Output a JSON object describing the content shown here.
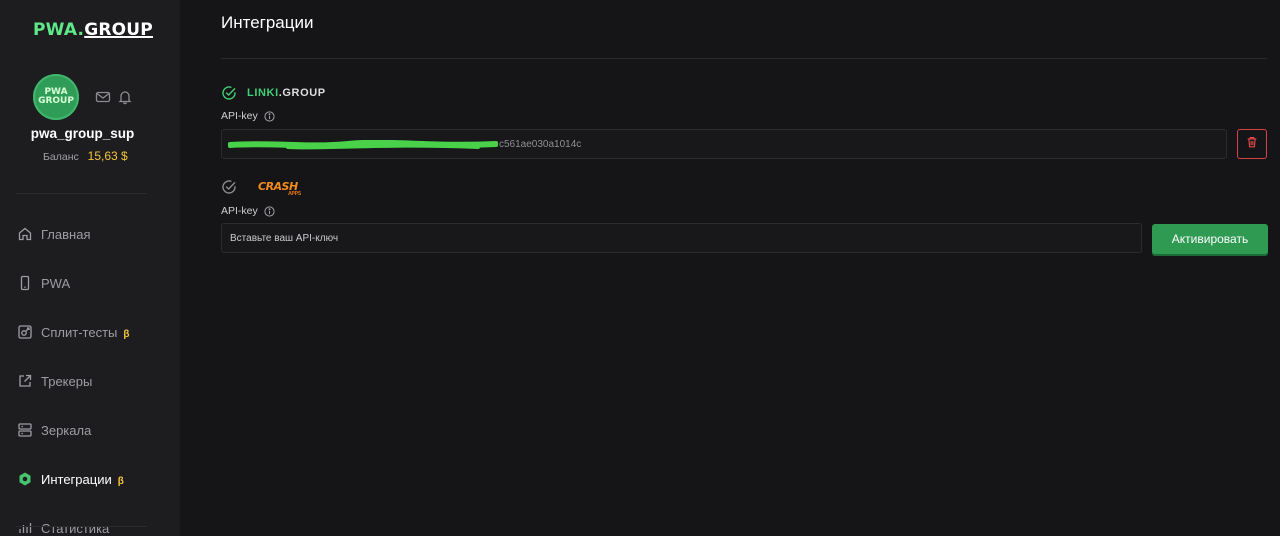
{
  "sidebar": {
    "logo_left": "PWA",
    "logo_dot": ".",
    "logo_right": "GROUP",
    "avatar_text_top": "PWA",
    "avatar_text_bottom": "GROUP",
    "username": "pwa_group_sup",
    "balance_label": "Баланс",
    "balance_value": "15,63 $",
    "beta_symbol": "β",
    "items": [
      {
        "label": "Главная",
        "icon": "home-icon",
        "beta": false,
        "active": false
      },
      {
        "label": "PWA",
        "icon": "phone-icon",
        "beta": false,
        "active": false
      },
      {
        "label": "Сплит-тесты",
        "icon": "split-icon",
        "beta": true,
        "active": false
      },
      {
        "label": "Трекеры",
        "icon": "share-icon",
        "beta": false,
        "active": false
      },
      {
        "label": "Зеркала",
        "icon": "server-icon",
        "beta": false,
        "active": false
      },
      {
        "label": "Интеграции",
        "icon": "integrations-icon",
        "beta": true,
        "active": true
      },
      {
        "label": "Статистика",
        "icon": "chart-icon",
        "beta": false,
        "active": false
      }
    ]
  },
  "main": {
    "title": "Интеграции",
    "integrations": [
      {
        "logo_accent": "LINKI",
        "logo_rest": ".GROUP",
        "connected": true,
        "field_label": "API-key",
        "key_visible_tail": "c561ae030a1014c"
      },
      {
        "logo_text": "CRASH",
        "logo_subtext": "APPS",
        "connected": false,
        "field_label": "API-key",
        "placeholder": "Вставьте ваш API-ключ",
        "button_label": "Активировать"
      }
    ]
  },
  "colors": {
    "accent_green": "#3fcf74",
    "beta_yellow": "#f5c53a",
    "danger_red": "#d54545"
  }
}
